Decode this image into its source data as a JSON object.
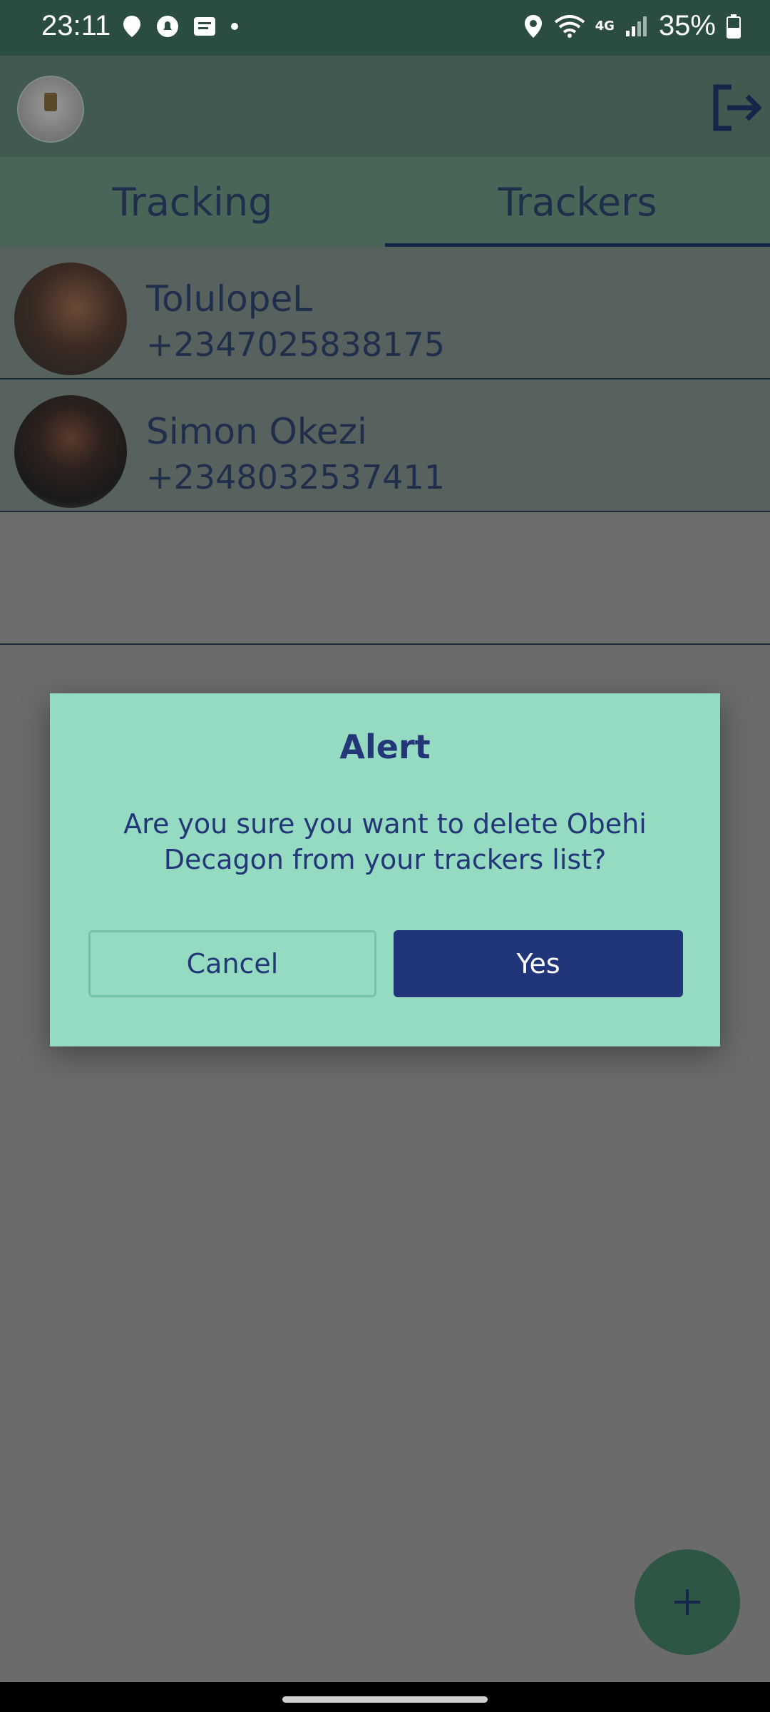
{
  "status_bar": {
    "time": "23:11",
    "battery_percent": "35%",
    "network_label": "4G",
    "left_icons": [
      "location-pin-icon",
      "notification-icon",
      "message-icon",
      "dot-icon"
    ],
    "right_icons": [
      "location-icon",
      "wifi-icon",
      "signal-icon",
      "battery-icon"
    ]
  },
  "app_bar": {
    "avatar_icon": "profile-avatar",
    "logout_icon": "logout-icon"
  },
  "tabs": [
    {
      "label": "Tracking",
      "active": false
    },
    {
      "label": "Trackers",
      "active": true
    }
  ],
  "trackers": [
    {
      "name": "TolulopeL",
      "phone": "+2347025838175"
    },
    {
      "name": "Simon Okezi",
      "phone": "+2348032537411"
    }
  ],
  "dialog": {
    "title": "Alert",
    "message": "Are you sure you want to delete Obehi Decagon from your trackers list?",
    "cancel_label": "Cancel",
    "confirm_label": "Yes"
  },
  "fab": {
    "icon": "plus-icon"
  },
  "colors": {
    "status_bar": "#2b4d40",
    "dialog_bg": "#95dbc1",
    "primary": "#21367a",
    "fab": "#2d5644"
  }
}
